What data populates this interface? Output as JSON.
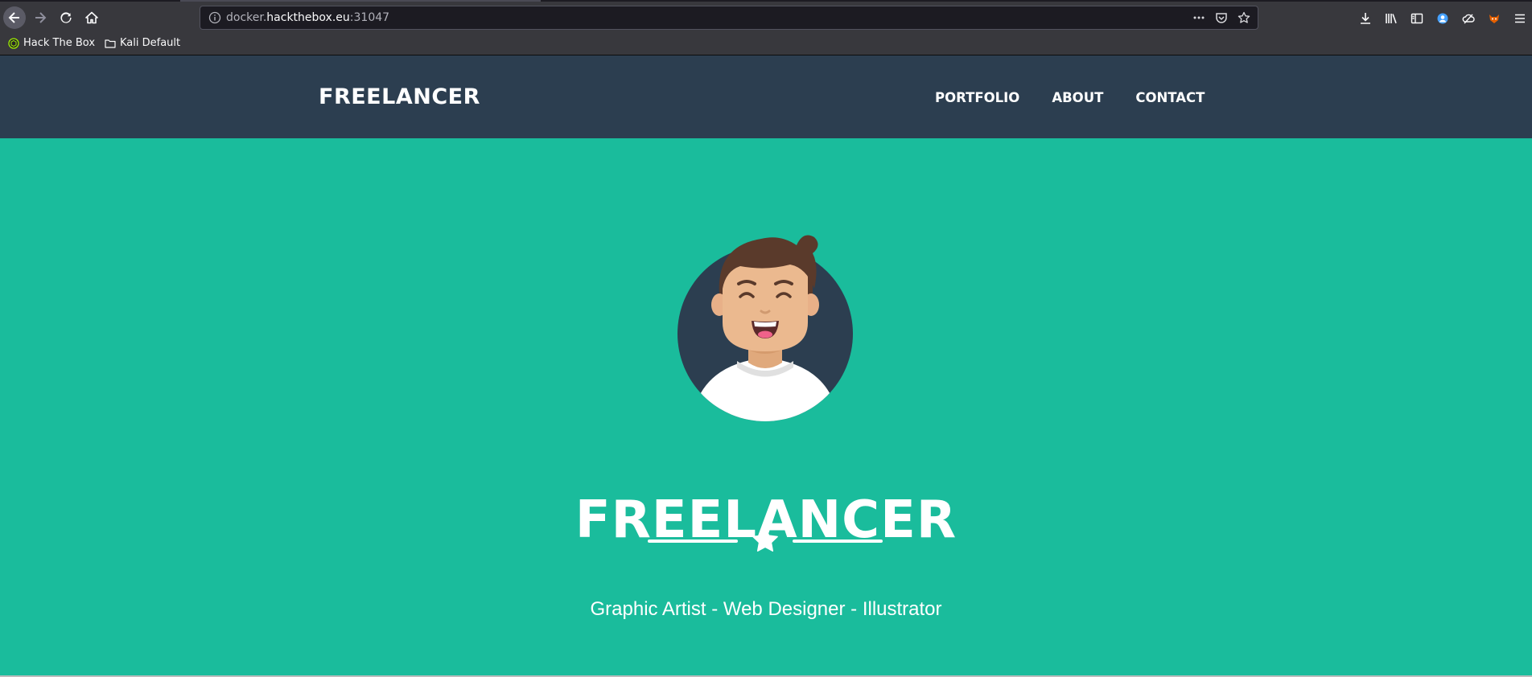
{
  "browser": {
    "url_prefix": "docker.",
    "url_host": "hackthebox.eu",
    "url_port": ":31047",
    "bookmarks": [
      {
        "label": "Hack The Box",
        "icon": "hackthebox-icon"
      },
      {
        "label": "Kali Default",
        "icon": "folder-icon"
      }
    ]
  },
  "site": {
    "brand": "FREELANCER",
    "nav": [
      "Portfolio",
      "About",
      "Contact"
    ],
    "hero": {
      "title": "FREELANCER",
      "subtitle": "Graphic Artist - Web Designer - Illustrator",
      "divider_icon": "star-icon",
      "avatar_icon": "avatar-illustration"
    }
  },
  "colors": {
    "nav_bg": "#2c3e50",
    "hero_bg": "#1abc9c",
    "text": "#ffffff"
  }
}
